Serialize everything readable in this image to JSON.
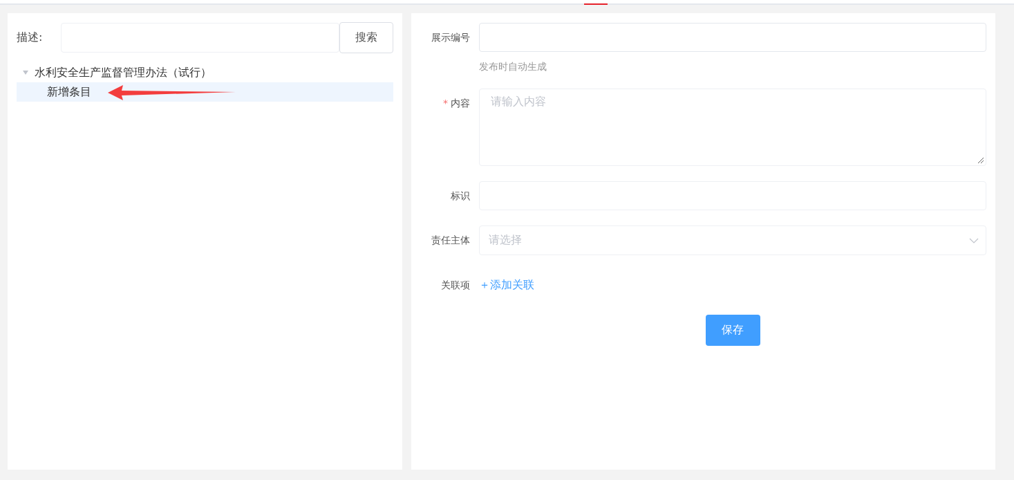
{
  "search": {
    "label": "描述:",
    "button": "搜索"
  },
  "tree": [
    {
      "label": "水利安全生产监督管理办法（试行）",
      "expanded": true,
      "selected": false,
      "children": [
        {
          "label": "新增条目",
          "selected": true
        }
      ]
    }
  ],
  "form": {
    "fields": [
      {
        "kind": "input",
        "label": "展示编号",
        "hint": "发布时自动生成"
      },
      {
        "kind": "textarea",
        "label": "内容",
        "required_mark": "*",
        "placeholder": "请输入内容"
      },
      {
        "kind": "input",
        "label": "标识"
      },
      {
        "kind": "select",
        "label": "责任主体",
        "placeholder": "请选择"
      },
      {
        "kind": "link",
        "label": "关联项",
        "link": "＋添加关联"
      }
    ],
    "submit": "保存"
  }
}
